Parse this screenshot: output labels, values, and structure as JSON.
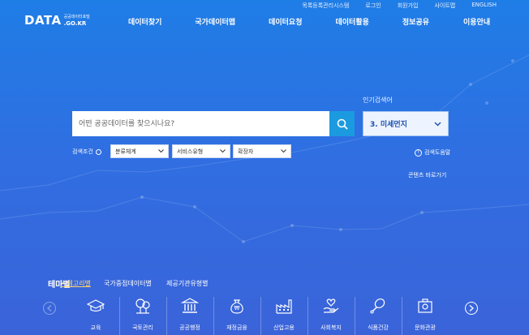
{
  "util_links": [
    "목록등록관리시스템",
    "로그인",
    "회원가입",
    "사이트맵",
    "ENGLISH"
  ],
  "logo": {
    "main": "DATA",
    "sub": "공공데이터포털",
    "domain": ".GO.KR"
  },
  "nav": [
    "데이터찾기",
    "국가데이터맵",
    "데이터요청",
    "데이터활용",
    "정보공유",
    "이용안내"
  ],
  "search": {
    "placeholder": "어떤 공공데이터를 찾으시나요?",
    "popular_label": "인기검색어",
    "popular_value": "3. 미세먼지"
  },
  "filters": {
    "label": "검색조건",
    "items": [
      "분류체계",
      "서비스유형",
      "확장자"
    ]
  },
  "links": {
    "help": "검색도움말",
    "shortcut": "콘텐츠 바로가기"
  },
  "theme": {
    "title": "테마별",
    "tabs": [
      "카테고리별",
      "국가중점데이터별",
      "제공기관유형별"
    ]
  },
  "categories": [
    {
      "label": "교육",
      "icon": "graduation-cap-icon"
    },
    {
      "label": "국토관리",
      "icon": "trees-icon"
    },
    {
      "label": "공공행정",
      "icon": "government-building-icon"
    },
    {
      "label": "재정금융",
      "icon": "money-bag-icon"
    },
    {
      "label": "산업고용",
      "icon": "factory-icon"
    },
    {
      "label": "사회복지",
      "icon": "hand-heart-icon"
    },
    {
      "label": "식품건강",
      "icon": "chicken-leg-icon"
    },
    {
      "label": "문화관광",
      "icon": "culture-icon"
    }
  ],
  "colors": {
    "accent_button": "#1b9ae0",
    "active_tab": "#ffd56a",
    "select_text": "#1b4fb0"
  }
}
